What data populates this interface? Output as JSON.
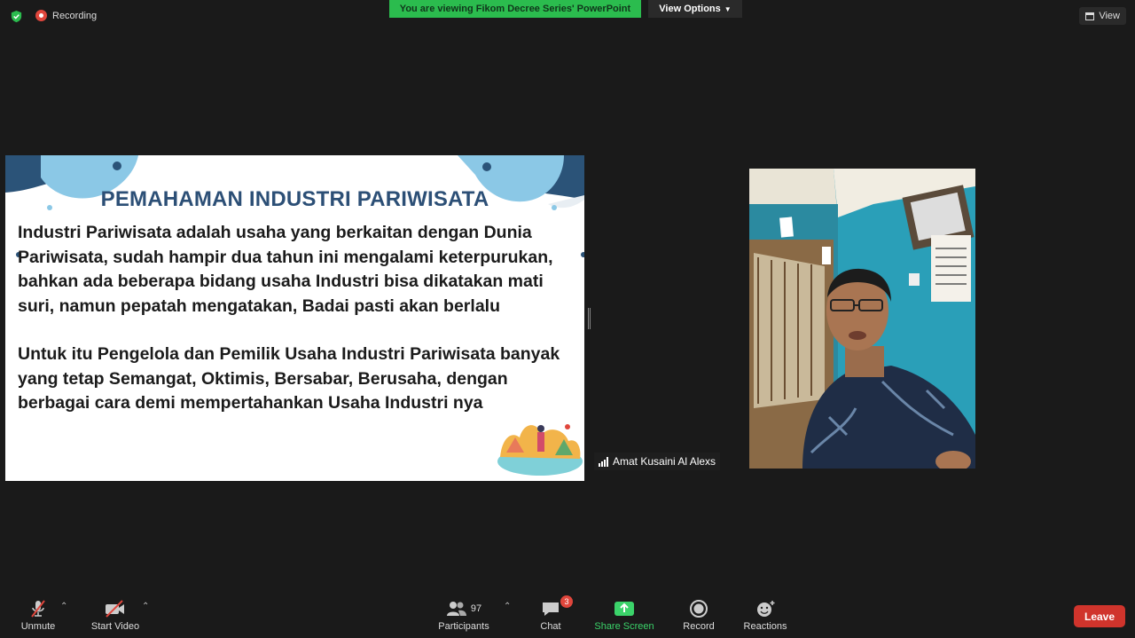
{
  "top": {
    "recording_label": "Recording",
    "banner": "You are viewing Fikom Decree Series' PowerPoint",
    "view_options": "View Options",
    "view_label": "View"
  },
  "slide": {
    "title": "PEMAHAMAN INDUSTRI PARIWISATA",
    "paragraph1": "Industri Pariwisata adalah usaha yang berkaitan dengan Dunia Pariwisata, sudah hampir dua tahun ini mengalami keterpurukan, bahkan ada beberapa bidang usaha Industri bisa dikatakan mati suri, namun pepatah mengatakan, Badai pasti akan berlalu",
    "paragraph2": "Untuk itu Pengelola dan Pemilik Usaha Industri Pariwisata banyak yang tetap Semangat, Oktimis, Bersabar, Berusaha, dengan berbagai cara demi mempertahankan  Usaha Industri nya"
  },
  "participant": {
    "name": "Amat Kusaini Al Alexs"
  },
  "toolbar": {
    "unmute": "Unmute",
    "start_video": "Start Video",
    "participants": "Participants",
    "participant_count": "97",
    "chat": "Chat",
    "chat_badge": "3",
    "share_screen": "Share Screen",
    "record": "Record",
    "reactions": "Reactions",
    "leave": "Leave"
  },
  "colors": {
    "banner_green": "#2bbc4e",
    "leave_red": "#d0342c",
    "slide_title": "#2c4f76",
    "share_green": "#3bd36a"
  }
}
